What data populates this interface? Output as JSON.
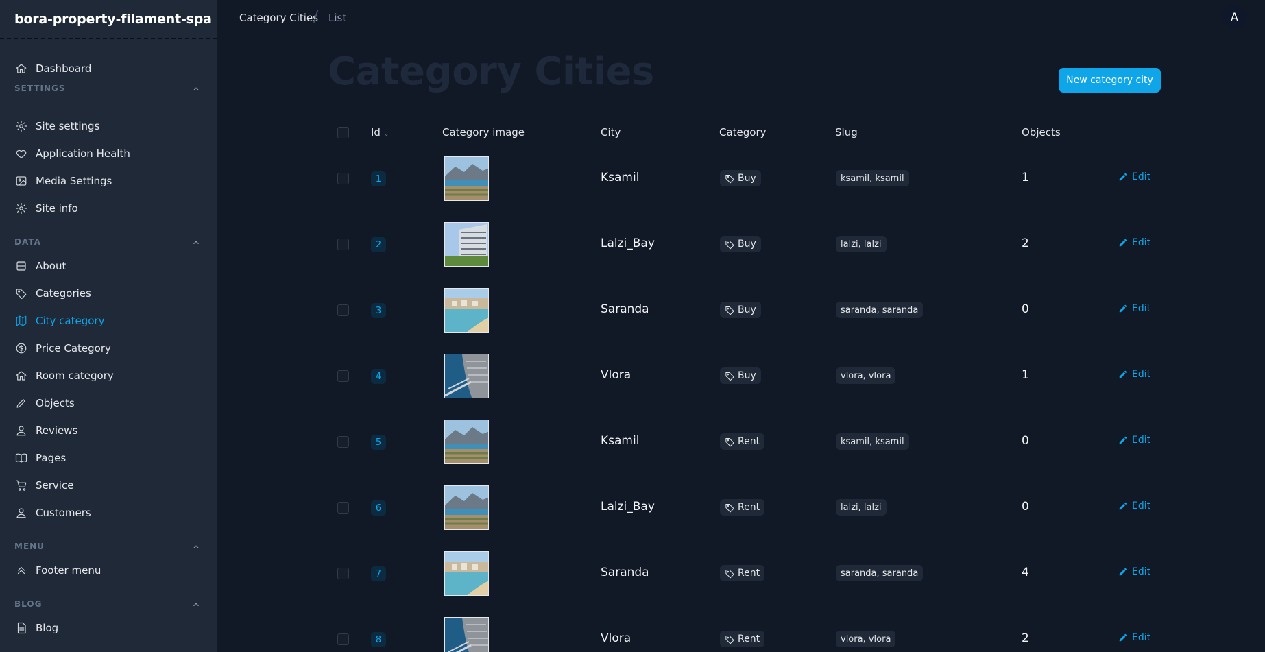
{
  "app": {
    "brand": "bora-property-filament-spa"
  },
  "sidebar": {
    "items": [
      {
        "label": "Dashboard",
        "icon": "home-icon"
      }
    ],
    "groups": {
      "settings": {
        "label": "SETTINGS",
        "items": [
          {
            "label": "Site settings",
            "icon": "gear-icon"
          },
          {
            "label": "Application Health",
            "icon": "heart-icon"
          },
          {
            "label": "Media Settings",
            "icon": "image-icon"
          },
          {
            "label": "Site info",
            "icon": "gear-icon"
          }
        ]
      },
      "data": {
        "label": "DATA",
        "items": [
          {
            "label": "About",
            "icon": "stack-icon"
          },
          {
            "label": "Categories",
            "icon": "tag-icon"
          },
          {
            "label": "City category",
            "icon": "map-icon",
            "active": true
          },
          {
            "label": "Price Category",
            "icon": "dollar-icon"
          },
          {
            "label": "Room category",
            "icon": "home-icon"
          },
          {
            "label": "Objects",
            "icon": "pencil-icon"
          },
          {
            "label": "Reviews",
            "icon": "user-icon"
          },
          {
            "label": "Pages",
            "icon": "book-icon"
          },
          {
            "label": "Service",
            "icon": "cart-icon"
          },
          {
            "label": "Customers",
            "icon": "user-icon"
          }
        ]
      },
      "menu": {
        "label": "MENU",
        "items": [
          {
            "label": "Footer menu",
            "icon": "chevron-double-up-icon"
          }
        ]
      },
      "blog": {
        "label": "BLOG",
        "items": [
          {
            "label": "Blog",
            "icon": "document-icon"
          }
        ]
      }
    }
  },
  "breadcrumb": {
    "first": "Category Cities",
    "separator": "/",
    "second": "List"
  },
  "user": {
    "avatar_initial": "A"
  },
  "page": {
    "title": "Category Cities",
    "new_button": "New category city"
  },
  "table": {
    "columns": {
      "id": "Id",
      "image": "Category image",
      "city": "City",
      "category": "Category",
      "slug": "Slug",
      "objects": "Objects"
    },
    "edit_label": "Edit",
    "rows": [
      {
        "id": "1",
        "city": "Ksamil",
        "category": "Buy",
        "slug": "ksamil, ksamil",
        "objects": "1",
        "image": "ksamil"
      },
      {
        "id": "2",
        "city": "Lalzi_Bay",
        "category": "Buy",
        "slug": "lalzi, lalzi",
        "objects": "2",
        "image": "lalzi"
      },
      {
        "id": "3",
        "city": "Saranda",
        "category": "Buy",
        "slug": "saranda, saranda",
        "objects": "0",
        "image": "saranda"
      },
      {
        "id": "4",
        "city": "Vlora",
        "category": "Buy",
        "slug": "vlora, vlora",
        "objects": "1",
        "image": "vlora"
      },
      {
        "id": "5",
        "city": "Ksamil",
        "category": "Rent",
        "slug": "ksamil, ksamil",
        "objects": "0",
        "image": "ksamil"
      },
      {
        "id": "6",
        "city": "Lalzi_Bay",
        "category": "Rent",
        "slug": "lalzi, lalzi",
        "objects": "0",
        "image": "ksamil"
      },
      {
        "id": "7",
        "city": "Saranda",
        "category": "Rent",
        "slug": "saranda, saranda",
        "objects": "4",
        "image": "saranda"
      },
      {
        "id": "8",
        "city": "Vlora",
        "category": "Rent",
        "slug": "vlora, vlora",
        "objects": "2",
        "image": "vlora"
      }
    ]
  },
  "colors": {
    "accent": "#0ea5e9",
    "background": "#111826",
    "sidebar": "#1f2937"
  }
}
